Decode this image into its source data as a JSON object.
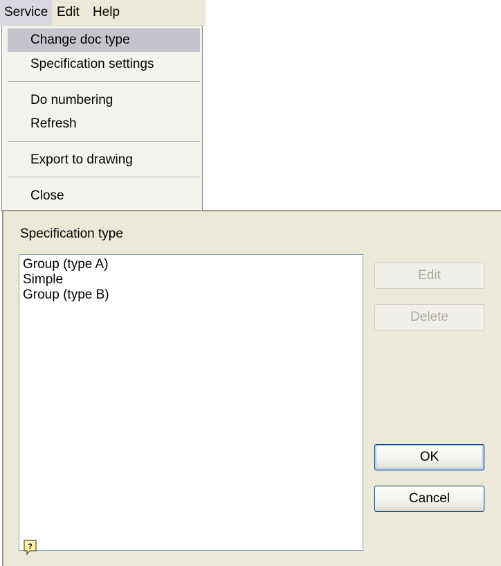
{
  "menubar": {
    "items": [
      {
        "label": "Service"
      },
      {
        "label": "Edit"
      },
      {
        "label": "Help"
      }
    ]
  },
  "dropdown": {
    "items": [
      {
        "label": "Change doc type"
      },
      {
        "label": "Specification settings"
      },
      {
        "label": "Do numbering"
      },
      {
        "label": "Refresh"
      },
      {
        "label": "Export to drawing"
      },
      {
        "label": "Close"
      }
    ]
  },
  "dialog": {
    "label": "Specification type",
    "list": [
      "Group (type A)",
      "Simple",
      "Group (type B)"
    ],
    "buttons": {
      "edit": "Edit",
      "delete": "Delete",
      "ok": "OK",
      "cancel": "Cancel"
    },
    "help_icon": "help-question-icon"
  },
  "colors": {
    "dialog_bg": "#ece9d8",
    "menu_highlight": "#c5c4cc",
    "list_border": "#7f9db9",
    "button_border": "#003c74"
  }
}
